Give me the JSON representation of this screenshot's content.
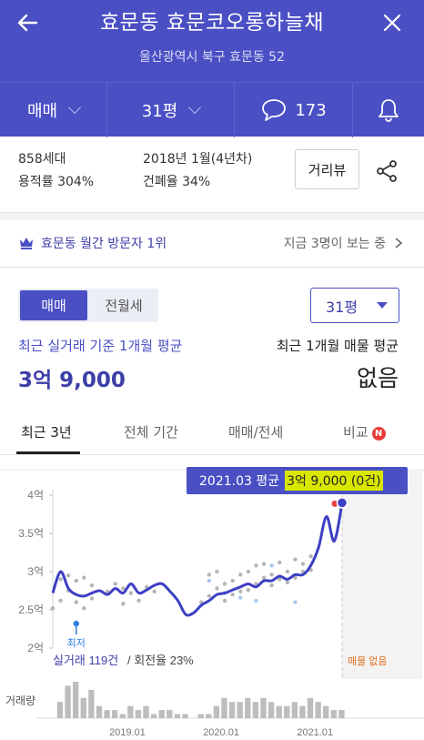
{
  "header": {
    "title": "효문동 효문코오롱하늘채",
    "address": "울산광역시 북구 효문동 52"
  },
  "filters": {
    "trade": "매매",
    "size": "31평",
    "comments": "173"
  },
  "info": {
    "households": "858세대",
    "floor_area_ratio": "용적률 304%",
    "built": "2018년 1월(4년차)",
    "coverage": "건폐율 34%",
    "street_view": "거리뷰"
  },
  "visit": {
    "rank": "효문동 월간 방문자 1위",
    "now": "지금 3명이 보는 중"
  },
  "segment": {
    "sale": "매매",
    "lease": "전월세"
  },
  "size_select": "31평",
  "price": {
    "recent_label": "최근 실거래 기준 1개월 평균",
    "recent_value": "3억 9,000",
    "listing_label": "최근 1개월 매물 평균",
    "listing_value": "없음"
  },
  "tabs": {
    "t1": "최근 3년",
    "t2": "전체 기간",
    "t3": "매매/전세",
    "t4": "비교",
    "badge": "N"
  },
  "tooltip": {
    "period": "2021.03 평균",
    "value": "3억 9,000 (0건)"
  },
  "chart_data": {
    "type": "line",
    "y_ticks": [
      "4억",
      "3.5억",
      "3억",
      "2.5억",
      "2억"
    ],
    "x_ticks": [
      "2019.01",
      "2020.01",
      "2021.01"
    ],
    "min_label": "최저",
    "deals_label": "실거래 119건",
    "turnover_label": "/ 회전율 23%",
    "no_listing_label": "매물 없음",
    "volume_label": "거래량",
    "ylim": [
      2.0,
      4.0
    ],
    "x_range": [
      "2018.03",
      "2021.03"
    ],
    "colors": {
      "line": "#3d3fc4",
      "dots": "#b5b5b5",
      "dots_alt": "#a9c8ee",
      "highlight": "#3d3fc4",
      "latest": "#e84040"
    },
    "series": [
      {
        "values": [
          2.72,
          3.0,
          2.78,
          2.7,
          2.68,
          2.72,
          2.75,
          2.7,
          2.78,
          2.72,
          2.84,
          2.72,
          2.76,
          2.82,
          2.84,
          2.74,
          2.62,
          2.44,
          2.46,
          2.56,
          2.62,
          2.7,
          2.72,
          2.76,
          2.8,
          2.84,
          2.8,
          2.88,
          2.88,
          2.94,
          2.9,
          2.96,
          2.96,
          3.08,
          3.32,
          3.72,
          3.4,
          3.9
        ]
      }
    ],
    "deal_points": [
      [
        0,
        2.52
      ],
      [
        1,
        2.9
      ],
      [
        1,
        2.62
      ],
      [
        2,
        2.95
      ],
      [
        2,
        2.75
      ],
      [
        3,
        2.88
      ],
      [
        3,
        2.6
      ],
      [
        4,
        2.92
      ],
      [
        4,
        2.52
      ],
      [
        5,
        2.82
      ],
      [
        5,
        2.65
      ],
      [
        7,
        2.74
      ],
      [
        8,
        2.84
      ],
      [
        9,
        2.78
      ],
      [
        9,
        2.58
      ],
      [
        10,
        2.72
      ],
      [
        11,
        2.62
      ],
      [
        12,
        2.8
      ],
      [
        13,
        2.74
      ],
      [
        19,
        2.6
      ],
      [
        20,
        2.96
      ],
      [
        20,
        2.68
      ],
      [
        21,
        2.78
      ],
      [
        21,
        3.0
      ],
      [
        22,
        2.84
      ],
      [
        22,
        2.62
      ],
      [
        23,
        2.7
      ],
      [
        23,
        2.88
      ],
      [
        24,
        2.96
      ],
      [
        24,
        2.74
      ],
      [
        25,
        3.0
      ],
      [
        25,
        2.76
      ],
      [
        26,
        2.84
      ],
      [
        26,
        3.08
      ],
      [
        27,
        2.92
      ],
      [
        27,
        3.1
      ],
      [
        28,
        2.96
      ],
      [
        28,
        2.82
      ],
      [
        29,
        3.12
      ],
      [
        29,
        2.9
      ],
      [
        30,
        3.0
      ],
      [
        30,
        2.86
      ],
      [
        31,
        3.16
      ],
      [
        31,
        2.92
      ],
      [
        32,
        3.0
      ],
      [
        32,
        3.1
      ],
      [
        33,
        3.02
      ],
      [
        33,
        3.2
      ]
    ],
    "deal_points_alt": [
      [
        20,
        2.88
      ],
      [
        22,
        2.72
      ],
      [
        24,
        2.66
      ],
      [
        26,
        2.62
      ],
      [
        28,
        3.08
      ],
      [
        31,
        2.6
      ]
    ],
    "min_point": [
      3,
      2.32
    ],
    "volume": [
      4,
      8,
      9,
      5,
      7,
      3,
      2,
      2,
      1,
      3,
      2,
      3,
      1,
      2,
      2,
      1,
      1,
      0,
      1,
      1,
      3,
      5,
      4,
      4,
      5,
      4,
      5,
      4,
      3,
      3,
      4,
      3,
      5,
      4,
      3,
      2,
      2,
      0
    ]
  }
}
